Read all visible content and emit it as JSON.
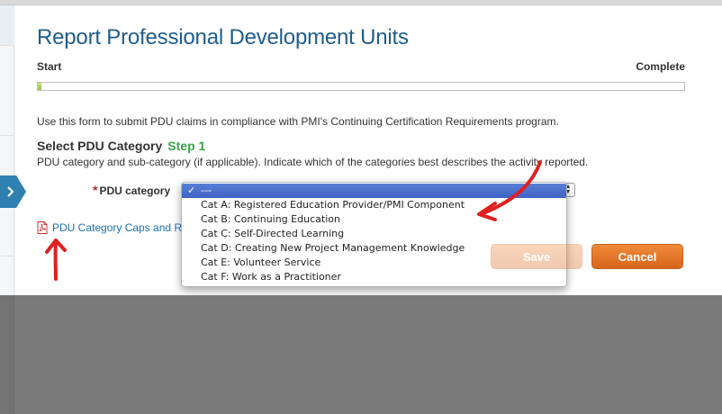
{
  "page": {
    "title": "Report Professional Development Units"
  },
  "progress": {
    "start_label": "Start",
    "complete_label": "Complete",
    "fraction": 0.005
  },
  "intro_text": "Use this form to submit PDU claims in compliance with PMI's Continuing Certification Requirements program.",
  "section": {
    "title": "Select PDU Category",
    "step": "Step 1",
    "description": "PDU category and sub-category (if applicable). Indicate which of the categories best describes the activity reported."
  },
  "field": {
    "required_mark": "*",
    "label": "PDU category",
    "selected_value": "---",
    "options": [
      "---",
      "Cat A: Registered Education Provider/PMI Component",
      "Cat B: Continuing Education",
      "Cat C: Self-Directed Learning",
      "Cat D: Creating New Project Management Knowledge",
      "Cat E: Volunteer Service",
      "Cat F: Work as a Practitioner"
    ],
    "check_glyph": "✓"
  },
  "pdf_link": {
    "label": "PDU Category Caps and R",
    "icon": "pdf-icon"
  },
  "buttons": {
    "save_label": "Save",
    "cancel_label": "Cancel"
  },
  "colors": {
    "title": "#1e5d8c",
    "step": "#3aa34a",
    "button": "#e0732a",
    "link": "#1e6fb0",
    "selection": "#3d63c4",
    "annotation": "#e02020"
  }
}
